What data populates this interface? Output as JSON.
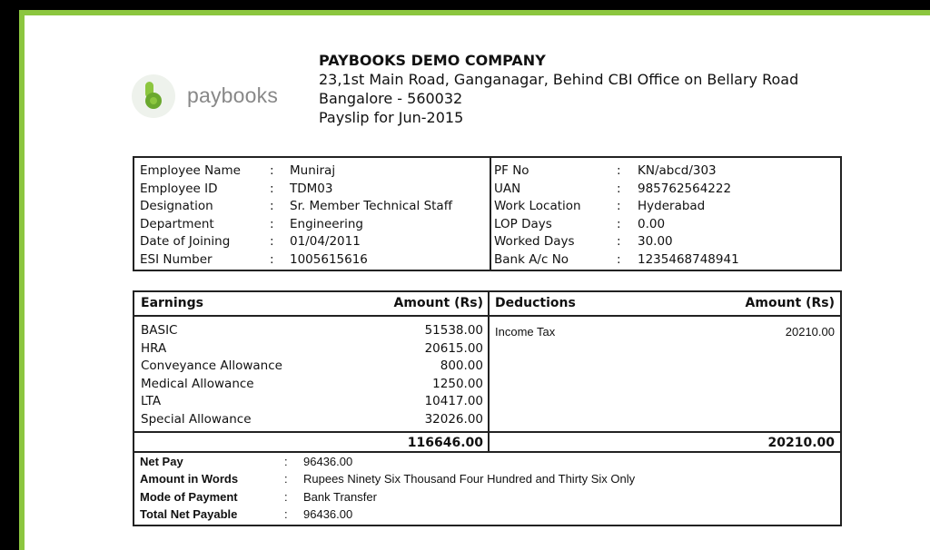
{
  "brand": {
    "logo_text": "paybooks",
    "accent_color": "#8cc63f"
  },
  "company": {
    "name": "PAYBOOKS DEMO COMPANY",
    "address_line1": "23,1st Main Road, Ganganagar, Behind CBI Office on Bellary Road",
    "address_line2": "Bangalore - 560032",
    "payslip_period": "Payslip for Jun-2015"
  },
  "employee": {
    "left": [
      {
        "label": "Employee Name",
        "value": "Muniraj"
      },
      {
        "label": "Employee ID",
        "value": "TDM03"
      },
      {
        "label": "Designation",
        "value": "Sr. Member Technical Staff"
      },
      {
        "label": "Department",
        "value": "Engineering"
      },
      {
        "label": "Date of Joining",
        "value": "01/04/2011"
      },
      {
        "label": "ESI Number",
        "value": "1005615616"
      }
    ],
    "right": [
      {
        "label": "PF No",
        "value": "KN/abcd/303"
      },
      {
        "label": "UAN",
        "value": "985762564222"
      },
      {
        "label": "Work Location",
        "value": "Hyderabad"
      },
      {
        "label": "LOP Days",
        "value": "0.00"
      },
      {
        "label": "Worked Days",
        "value": "30.00"
      },
      {
        "label": "Bank A/c No",
        "value": "1235468748941"
      }
    ]
  },
  "earnings": {
    "header": "Earnings",
    "amount_header": "Amount (Rs)",
    "items": [
      {
        "name": "BASIC",
        "amount": "51538.00"
      },
      {
        "name": "HRA",
        "amount": "20615.00"
      },
      {
        "name": "Conveyance Allowance",
        "amount": "800.00"
      },
      {
        "name": "Medical Allowance",
        "amount": "1250.00"
      },
      {
        "name": "LTA",
        "amount": "10417.00"
      },
      {
        "name": "Special Allowance",
        "amount": "32026.00"
      }
    ],
    "total": "116646.00"
  },
  "deductions": {
    "header": "Deductions",
    "amount_header": "Amount (Rs)",
    "items": [
      {
        "name": "Income Tax",
        "amount": "20210.00"
      }
    ],
    "total": "20210.00"
  },
  "summary": [
    {
      "label": "Net Pay",
      "value": "96436.00"
    },
    {
      "label": "Amount in Words",
      "value": "Rupees Ninety Six Thousand Four Hundred and Thirty Six Only"
    },
    {
      "label": "Mode of Payment",
      "value": "Bank Transfer"
    },
    {
      "label": "Total Net Payable",
      "value": "96436.00"
    }
  ],
  "separator": ":"
}
